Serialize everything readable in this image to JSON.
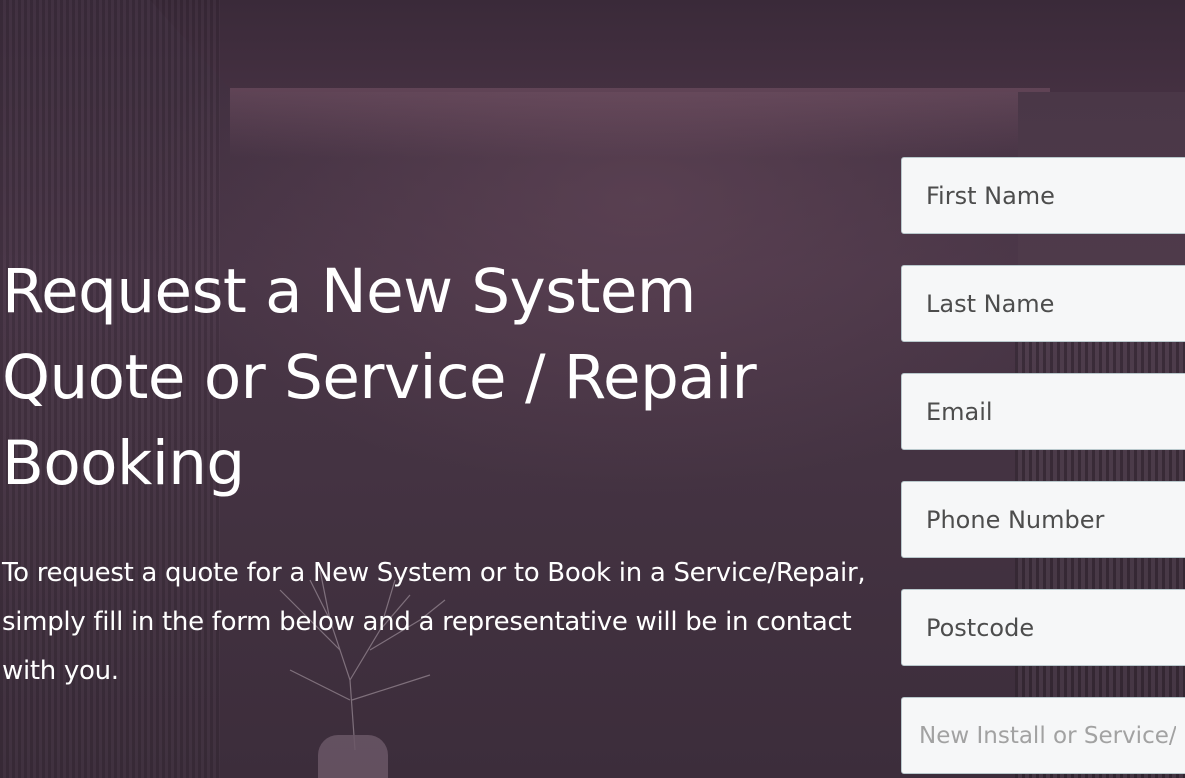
{
  "hero": {
    "title": "Request a New System Quote or Service / Repair Booking",
    "description": "To request a quote for a New System or to Book in a Service/Repair, simply fill in the form below and a representative will be in contact with you."
  },
  "form": {
    "fields": [
      {
        "placeholder": "First Name"
      },
      {
        "placeholder": "Last Name"
      },
      {
        "placeholder": "Email"
      },
      {
        "placeholder": "Phone Number"
      },
      {
        "placeholder": "Postcode"
      },
      {
        "placeholder": "New Install or Service/Repair"
      }
    ]
  }
}
